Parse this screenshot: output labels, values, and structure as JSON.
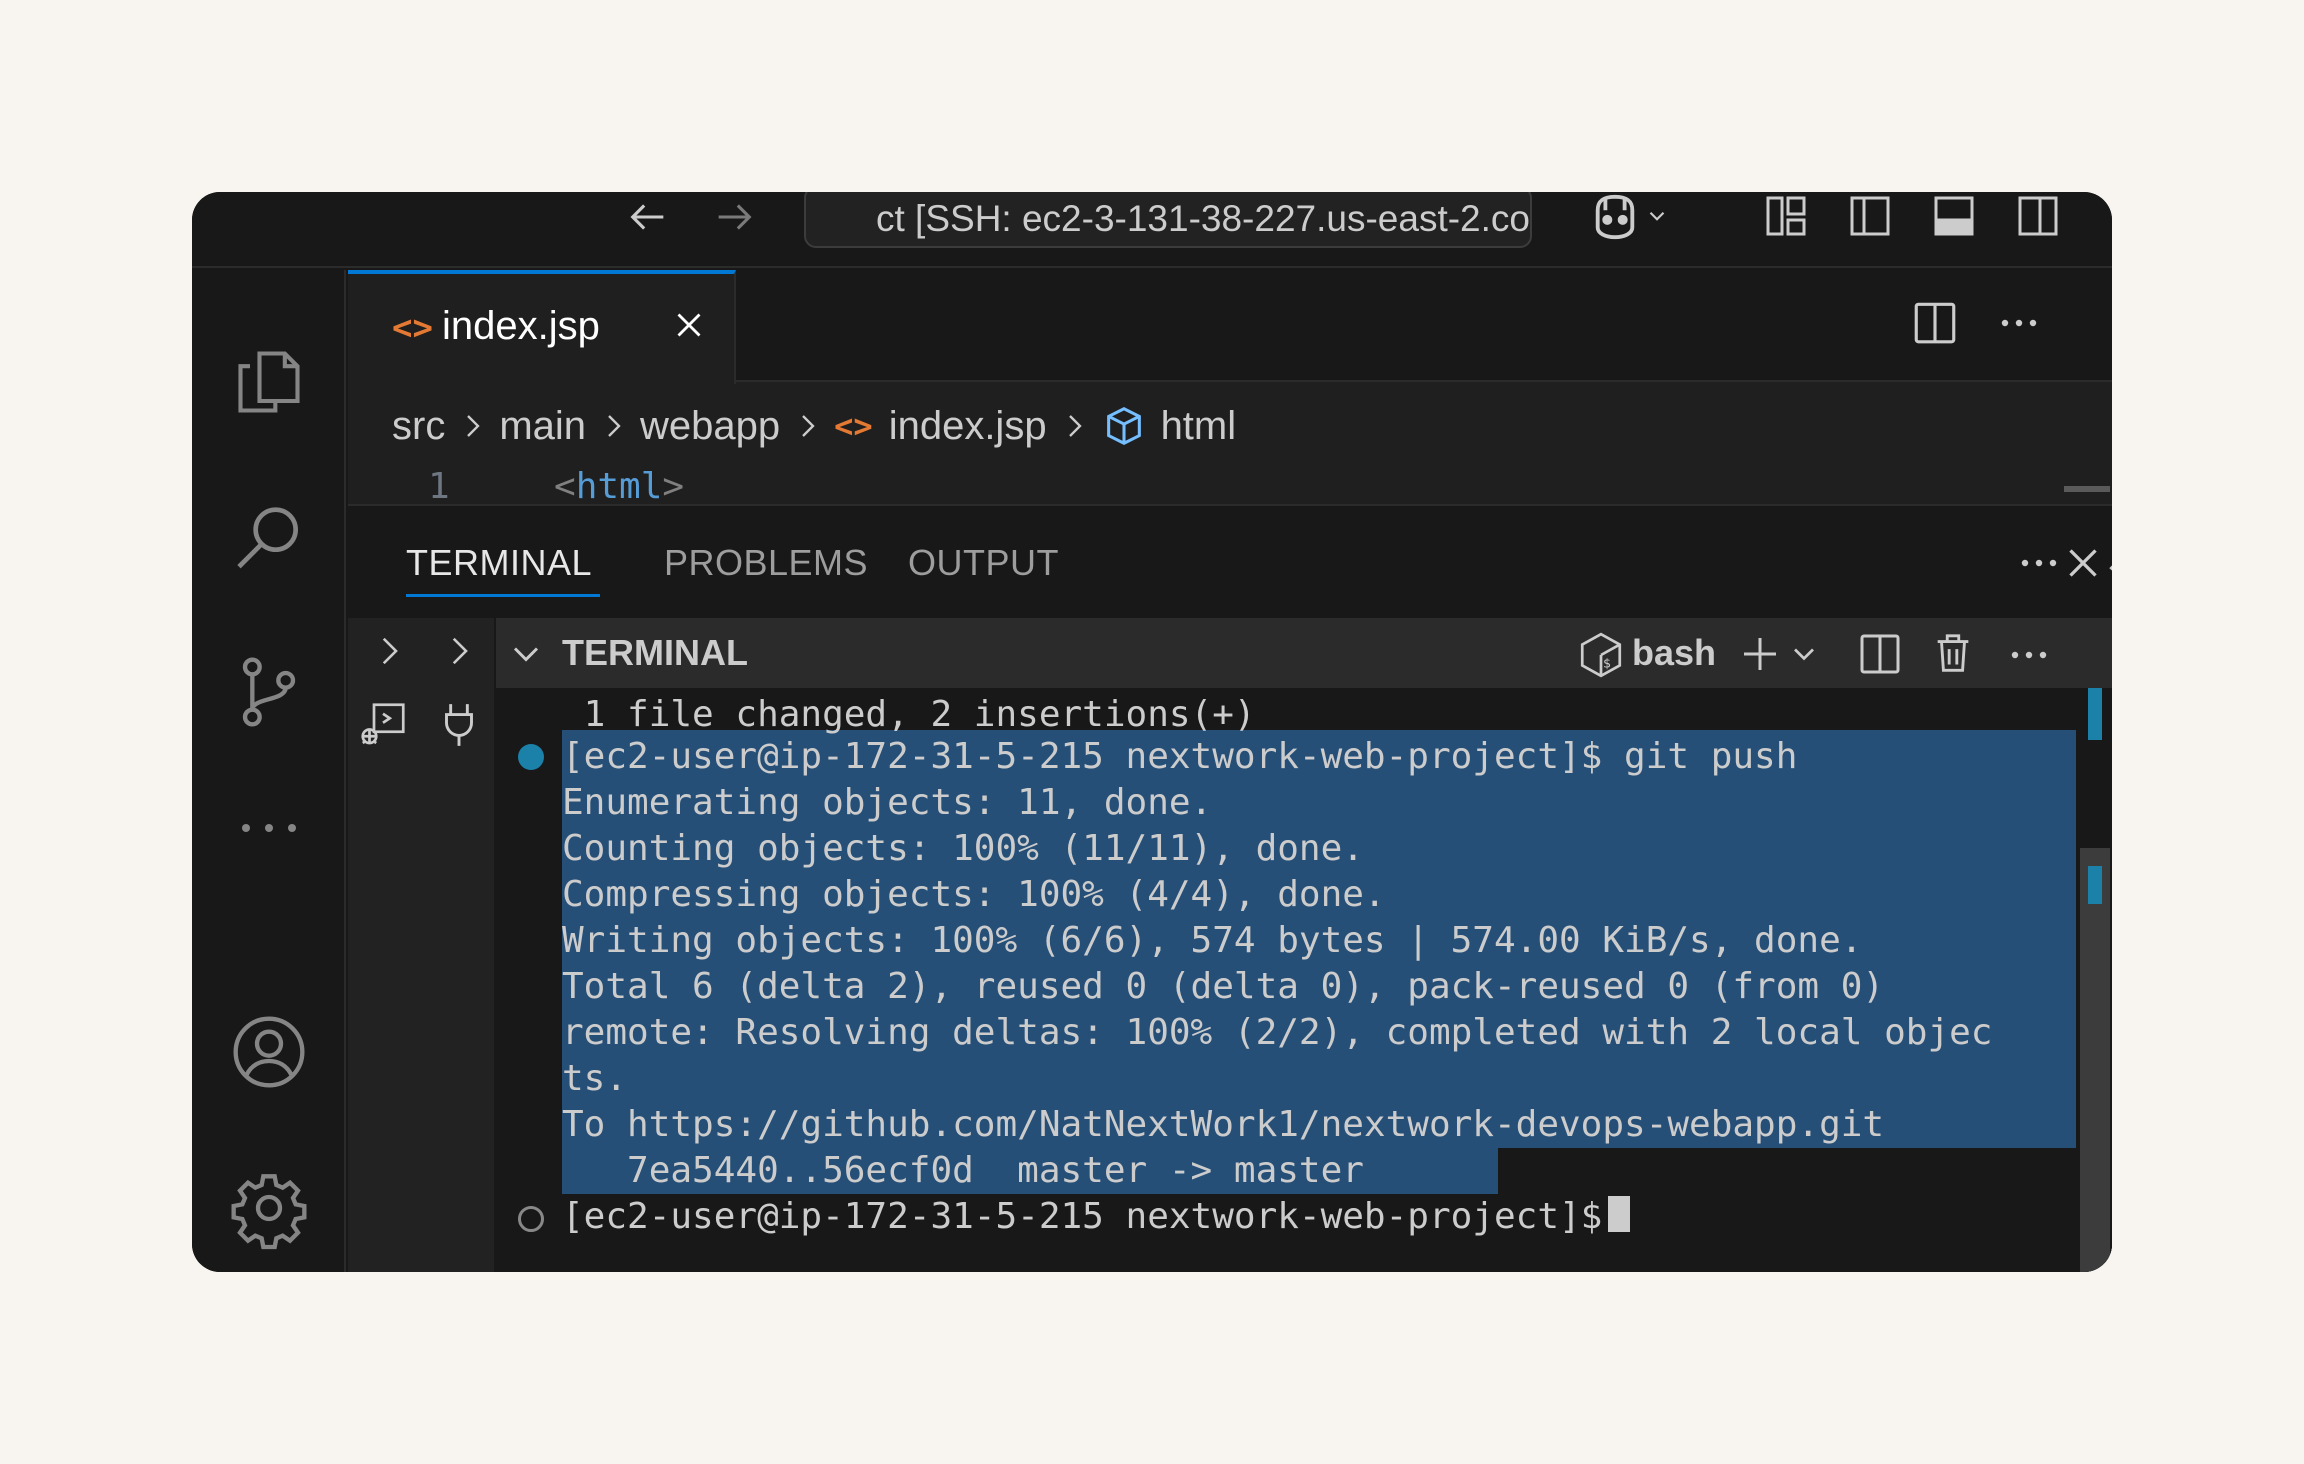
{
  "titlebar": {
    "command_center": "ct [SSH: ec2-3-131-38-227.us-east-2.co"
  },
  "tab": {
    "label": "index.jsp"
  },
  "breadcrumb": [
    "src",
    "main",
    "webapp",
    "index.jsp",
    "html"
  ],
  "code": {
    "line_number": "1",
    "open": "<",
    "tag": "html",
    "close": ">"
  },
  "panel": {
    "tabs": [
      "TERMINAL",
      "PROBLEMS",
      "OUTPUT"
    ],
    "terminal_title": "TERMINAL",
    "shell": "bash"
  },
  "terminal": {
    "lines": [
      " 1 file changed, 2 insertions(+)",
      "[ec2-user@ip-172-31-5-215 nextwork-web-project]$ git push",
      "Enumerating objects: 11, done.",
      "Counting objects: 100% (11/11), done.",
      "Compressing objects: 100% (4/4), done.",
      "Writing objects: 100% (6/6), 574 bytes | 574.00 KiB/s, done.",
      "Total 6 (delta 2), reused 0 (delta 0), pack-reused 0 (from 0)",
      "remote: Resolving deltas: 100% (2/2), completed with 2 local objec",
      "ts.",
      "To https://github.com/NatNextWork1/nextwork-devops-webapp.git",
      "   7ea5440..56ecf0d  master -> master",
      "[ec2-user@ip-172-31-5-215 nextwork-web-project]$"
    ]
  },
  "icons": {
    "nav_back": "arrow-left-icon",
    "nav_forward": "arrow-right-icon",
    "copilot": "copilot-icon",
    "explorer": "files-icon",
    "search": "search-icon",
    "source_control": "source-control-icon",
    "more": "ellipsis-icon",
    "account": "account-icon",
    "settings": "gear-icon"
  },
  "colors": {
    "accent": "#0078d4",
    "selection": "#264f78",
    "file_icon": "#e37933",
    "html_tag": "#569cd6",
    "decoration": "#1b81a8"
  }
}
